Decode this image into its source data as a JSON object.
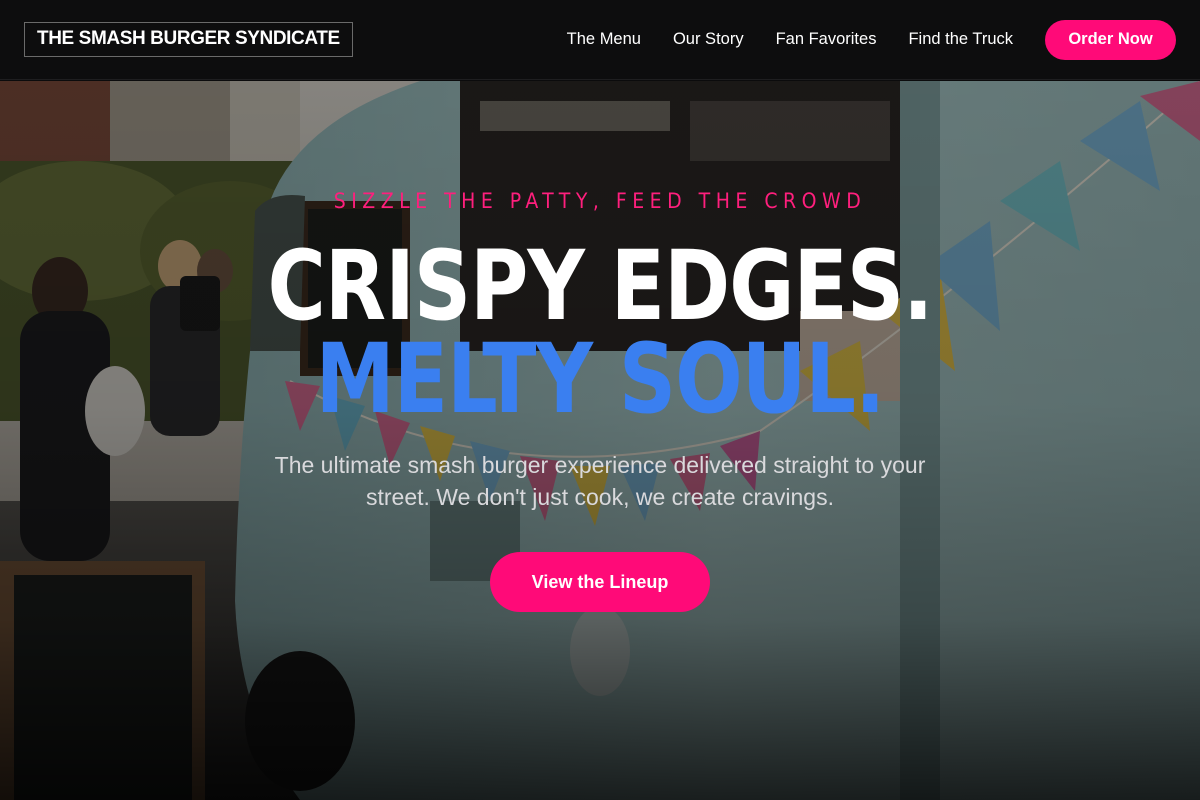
{
  "header": {
    "logo": "THE SMASH BURGER SYNDICATE",
    "nav": [
      {
        "label": "The Menu"
      },
      {
        "label": "Our Story"
      },
      {
        "label": "Fan Favorites"
      },
      {
        "label": "Find the Truck"
      }
    ],
    "cta_label": "Order Now"
  },
  "hero": {
    "tagline": "SIZZLE THE PATTY, FEED THE CROWD",
    "headline_line1": "CRISPY EDGES.",
    "headline_line2": "MELTY SOUL.",
    "subcopy": "The ultimate smash burger experience delivered straight to your street. We don't just cook, we create cravings.",
    "button_label": "View the Lineup"
  },
  "colors": {
    "accent_pink": "#ff0a78",
    "accent_blue": "#3a7ff0",
    "header_bg": "#0d0d0e"
  }
}
